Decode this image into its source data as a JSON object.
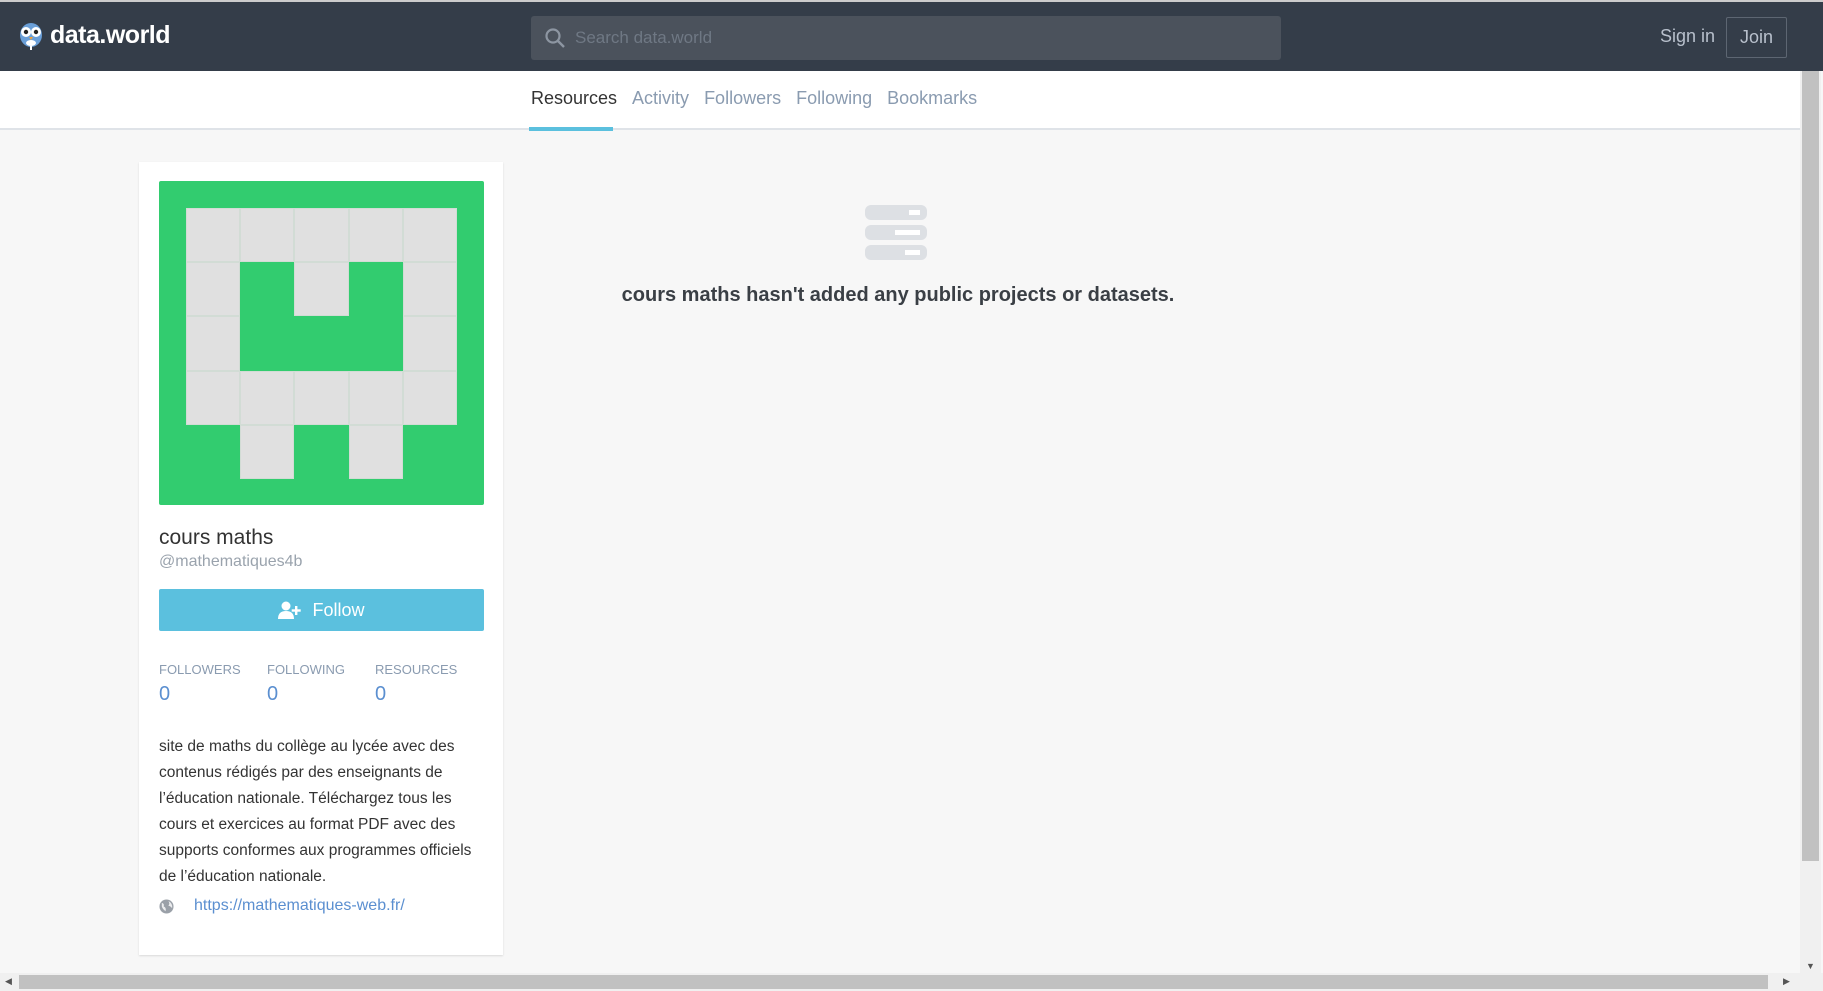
{
  "header": {
    "logo_text": "data.world",
    "search_placeholder": "Search data.world",
    "sign_in": "Sign in",
    "join": "Join"
  },
  "tabs": [
    {
      "label": "Resources"
    },
    {
      "label": "Activity"
    },
    {
      "label": "Followers"
    },
    {
      "label": "Following"
    },
    {
      "label": "Bookmarks"
    }
  ],
  "profile": {
    "name": "cours maths",
    "handle": "@mathematiques4b",
    "follow_label": "Follow",
    "stats": [
      {
        "label": "FOLLOWERS",
        "value": "0"
      },
      {
        "label": "FOLLOWING",
        "value": "0"
      },
      {
        "label": "RESOURCES",
        "value": "0"
      }
    ],
    "description": "site de maths du collège au lycée avec des contenus rédigés par des enseignants de l’éducation nationale. Téléchargez tous les cours et exercices au format PDF avec des supports conformes aux programmes officiels de l’éducation nationale.",
    "website": "https://mathematiques-web.fr/",
    "avatar_color": "#32cc6f"
  },
  "empty_state": {
    "message": "cours maths hasn't added any public projects or datasets."
  }
}
